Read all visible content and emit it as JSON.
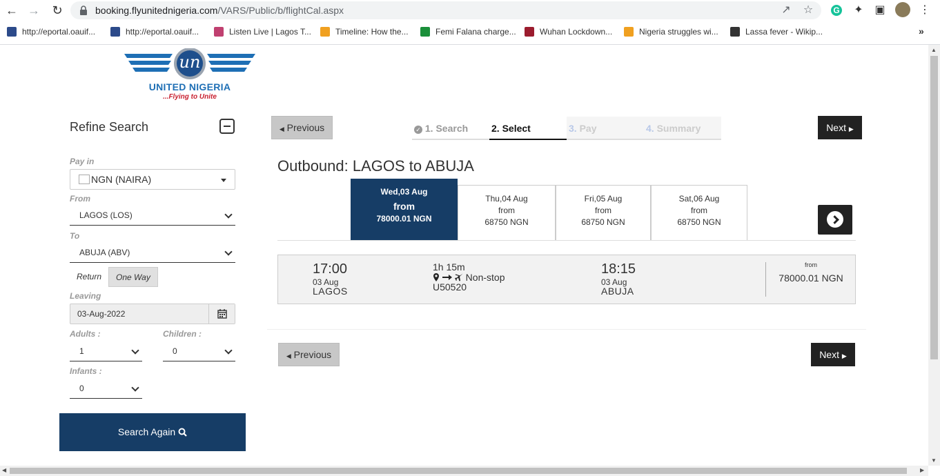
{
  "browser": {
    "url_host": "booking.flyunitednigeria.com",
    "url_path": "/VARS/Public/b/flightCal.aspx",
    "bookmarks": [
      {
        "label": "http://eportal.oauif...",
        "color": "#2c4a8a"
      },
      {
        "label": "http://eportal.oauif...",
        "color": "#2c4a8a"
      },
      {
        "label": "Listen Live | Lagos T...",
        "color": "#c04070"
      },
      {
        "label": "Timeline: How the...",
        "color": "#f0a020"
      },
      {
        "label": "Femi Falana charge...",
        "color": "#1a8f3a"
      },
      {
        "label": "Wuhan Lockdown...",
        "color": "#9b1c2e"
      },
      {
        "label": "Nigeria struggles wi...",
        "color": "#f0a020"
      },
      {
        "label": "Lassa fever - Wikip...",
        "color": "#333333"
      }
    ],
    "more": "»"
  },
  "logo": {
    "name": "UNITED NIGERIA",
    "tagline": "...Flying to Unite",
    "mark": "un"
  },
  "sidebar": {
    "title": "Refine Search",
    "pay_in_label": "Pay in",
    "pay_in_value": "NGN (NAIRA)",
    "from_label": "From",
    "from_value": "LAGOS (LOS)",
    "to_label": "To",
    "to_value": "ABUJA (ABV)",
    "trip_return": "Return",
    "trip_oneway": "One Way",
    "leaving_label": "Leaving",
    "leaving_value": "03-Aug-2022",
    "adults_label": "Adults",
    "adults_value": "1",
    "children_label": "Children",
    "children_value": "0",
    "infants_label": "Infants",
    "infants_value": "0",
    "search_again": "Search Again"
  },
  "steps": {
    "prev": "Previous",
    "next": "Next",
    "items": [
      {
        "num": "1.",
        "label": "Search"
      },
      {
        "num": "2.",
        "label": "Select"
      },
      {
        "num": "3.",
        "label": "Pay"
      },
      {
        "num": "4.",
        "label": "Summary"
      }
    ]
  },
  "outbound": {
    "title": "Outbound: LAGOS to ABUJA",
    "days": [
      {
        "date": "Wed,03 Aug",
        "from": "from",
        "price": "78000.01 NGN"
      },
      {
        "date": "Thu,04 Aug",
        "from": "from",
        "price": "68750 NGN"
      },
      {
        "date": "Fri,05 Aug",
        "from": "from",
        "price": "68750 NGN"
      },
      {
        "date": "Sat,06 Aug",
        "from": "from",
        "price": "68750 NGN"
      }
    ]
  },
  "flight": {
    "dep_time": "17:00",
    "dep_date": "03 Aug",
    "dep_city": "LAGOS",
    "duration": "1h 15m",
    "stops": "Non-stop",
    "flight_no": "U50520",
    "arr_time": "18:15",
    "arr_date": "03 Aug",
    "arr_city": "ABUJA",
    "price_from": "from",
    "price": "78000.01 NGN"
  },
  "bottom_nav": {
    "prev": "Previous",
    "next": "Next"
  }
}
